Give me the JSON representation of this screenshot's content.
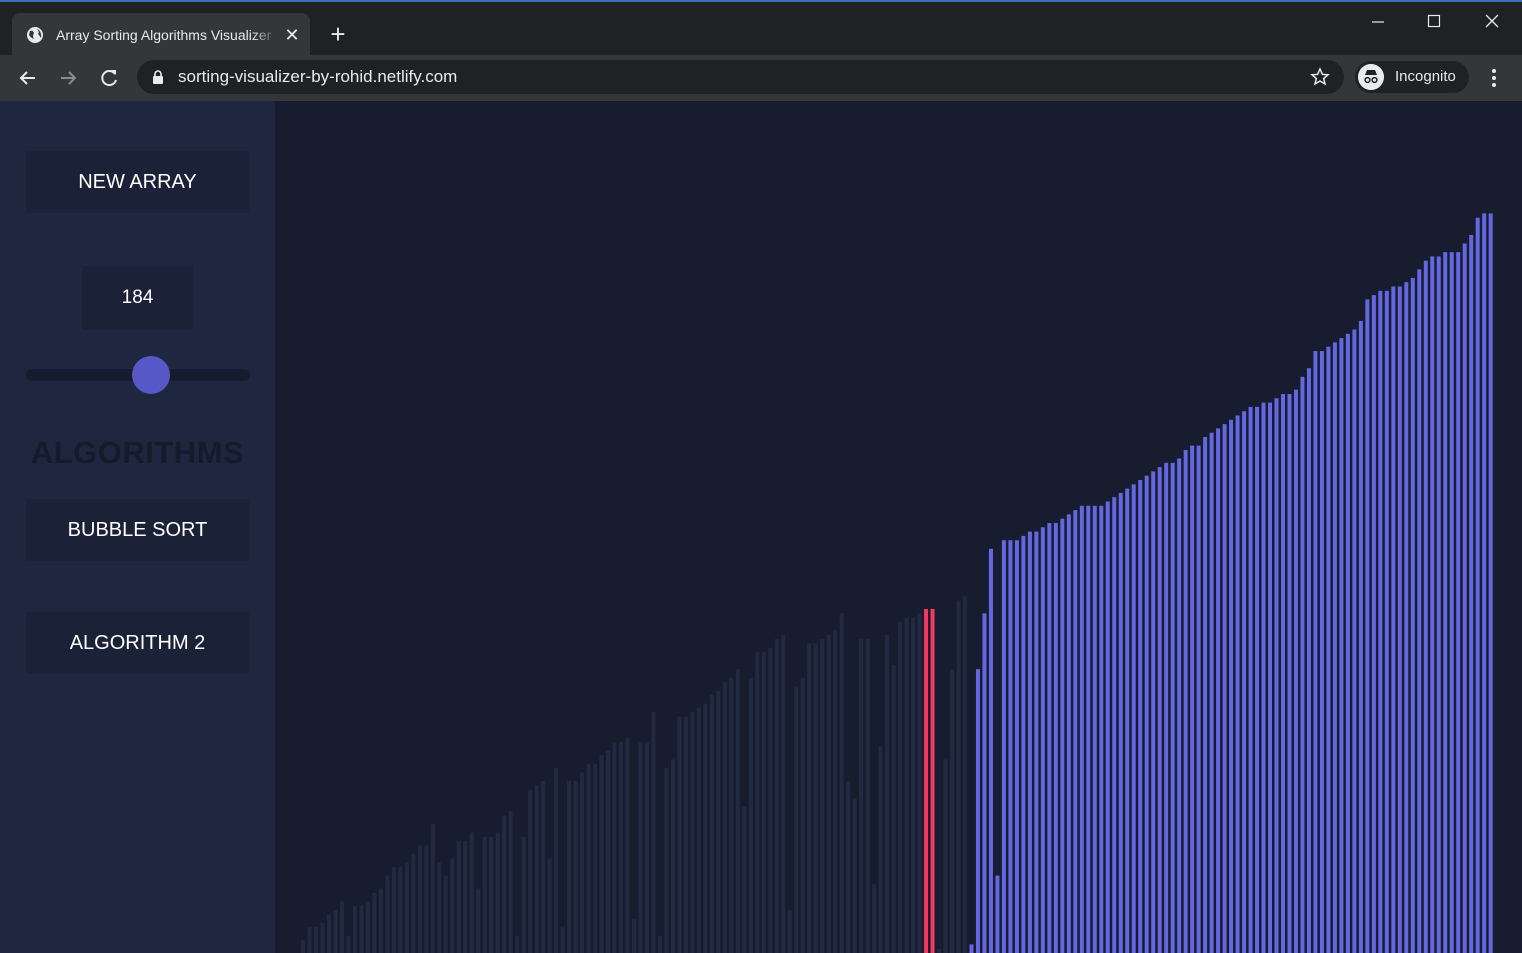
{
  "browser": {
    "tab_title": "Array Sorting Algorithms Visualizer",
    "url": "sorting-visualizer-by-rohid.netlify.com",
    "profile_label": "Incognito"
  },
  "sidebar": {
    "new_array_label": "NEW ARRAY",
    "array_size": "184",
    "slider_value": 184,
    "algorithms_heading": "ALGORITHMS",
    "algorithm_buttons": [
      "BUBBLE SORT",
      "ALGORITHM 2"
    ]
  },
  "colors": {
    "sorted_bar": "#6567e0",
    "unsorted_bar": "#222a42",
    "compare_bar": "#f03a62",
    "accent": "#5558c6",
    "page_background": "#171c2e"
  },
  "chart_data": {
    "type": "bar",
    "values": [
      3,
      6,
      6,
      7,
      9,
      10,
      12,
      4,
      11,
      11,
      12,
      14,
      15,
      18,
      20,
      20,
      21,
      23,
      25,
      25,
      30,
      21,
      18,
      22,
      26,
      26,
      28,
      15,
      27,
      27,
      28,
      32,
      33,
      4,
      27,
      38,
      39,
      40,
      22,
      43,
      6,
      40,
      40,
      42,
      44,
      44,
      46,
      47,
      49,
      49,
      50,
      8,
      49,
      49,
      56,
      4,
      43,
      45,
      55,
      55,
      56,
      57,
      58,
      60,
      61,
      63,
      64,
      66,
      34,
      64,
      70,
      70,
      71,
      73,
      74,
      10,
      62,
      64,
      72,
      72,
      73,
      74,
      75,
      79,
      40,
      36,
      73,
      73,
      16,
      48,
      74,
      67,
      77,
      78,
      78,
      79,
      80,
      80,
      1,
      45,
      66,
      82,
      83,
      2,
      66,
      79,
      94,
      18,
      96,
      96,
      96,
      97,
      98,
      98,
      99,
      100,
      100,
      101,
      102,
      103,
      104,
      104,
      104,
      104,
      105,
      106,
      107,
      108,
      109,
      110,
      111,
      112,
      113,
      114,
      114,
      115,
      117,
      118,
      118,
      120,
      121,
      122,
      123,
      124,
      125,
      126,
      127,
      127,
      128,
      128,
      129,
      130,
      130,
      131,
      134,
      136,
      140,
      140,
      141,
      142,
      143,
      144,
      145,
      147,
      152,
      153,
      154,
      154,
      155,
      155,
      156,
      157,
      159,
      161,
      162,
      162,
      163,
      163,
      163,
      165,
      167,
      171,
      172,
      172
    ],
    "sorted_from_index": 103,
    "compare_indices": [
      96,
      97
    ]
  }
}
